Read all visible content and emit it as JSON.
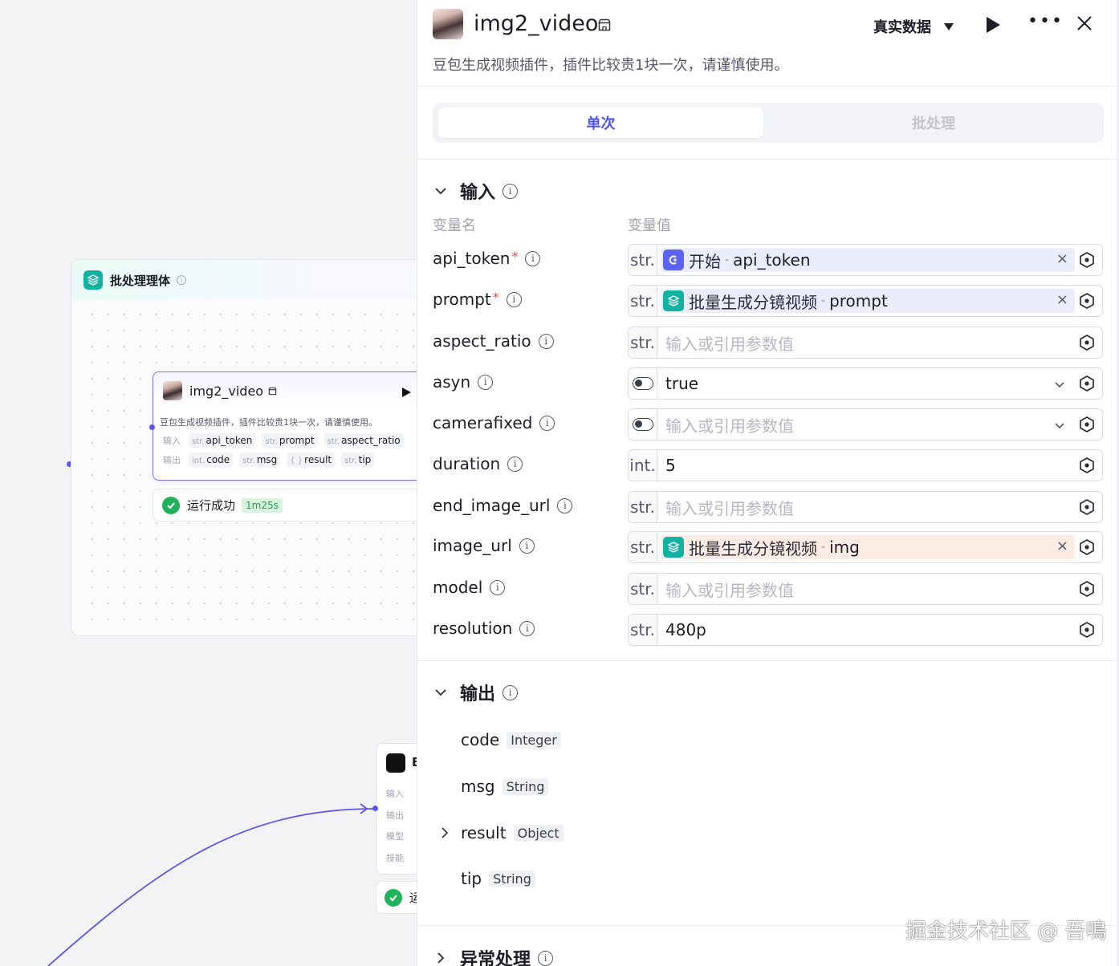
{
  "canvas": {
    "batch_group": {
      "title": "批处理理体"
    },
    "node": {
      "title": "img2_video",
      "description": "豆包生成视频插件，插件比较贵1块一次，请谨慎使用。",
      "input_label": "输入",
      "output_label": "输出",
      "inputs": [
        {
          "type": "str.",
          "name": "api_token"
        },
        {
          "type": "str.",
          "name": "prompt"
        },
        {
          "type": "str.",
          "name": "aspect_ratio"
        }
      ],
      "outputs": [
        {
          "type": "int.",
          "name": "code"
        },
        {
          "type": "str.",
          "name": "msg"
        },
        {
          "type": "{ }",
          "name": "result"
        },
        {
          "type": "str.",
          "name": "tip"
        }
      ]
    },
    "run_status": {
      "text": "运行成功",
      "duration": "1m25s"
    },
    "node2": {
      "title_partial": "E",
      "labels": [
        "输入",
        "输出",
        "模型",
        "技能"
      ],
      "status_partial": "运"
    }
  },
  "panel": {
    "title": "img2_video",
    "description": "豆包生成视频插件，插件比较贵1块一次，请谨慎使用。",
    "mode_label": "真实数据",
    "tabs": {
      "single": "单次",
      "batch": "批处理"
    },
    "input_section": {
      "title": "输入",
      "col_name": "变量名",
      "col_value": "变量值",
      "params": [
        {
          "name": "api_token",
          "required": "*",
          "type": "str.",
          "ref_source": "开始",
          "ref_var": "api_token"
        },
        {
          "name": "prompt",
          "required": "*",
          "type": "str.",
          "ref_source": "批量生成分镜视频",
          "ref_var": "prompt"
        },
        {
          "name": "aspect_ratio",
          "type": "str.",
          "placeholder": "输入或引用参数值"
        },
        {
          "name": "asyn",
          "type": "toggle",
          "value": "true"
        },
        {
          "name": "camerafixed",
          "type": "toggle",
          "placeholder": "输入或引用参数值"
        },
        {
          "name": "duration",
          "type": "int.",
          "value": "5"
        },
        {
          "name": "end_image_url",
          "type": "str.",
          "placeholder": "输入或引用参数值"
        },
        {
          "name": "image_url",
          "type": "str.",
          "ref_source": "批量生成分镜视频",
          "ref_var": "img"
        },
        {
          "name": "model",
          "type": "str.",
          "placeholder": "输入或引用参数值"
        },
        {
          "name": "resolution",
          "type": "str.",
          "value": "480p"
        }
      ],
      "ref_separator": "-"
    },
    "output_section": {
      "title": "输出",
      "outputs": [
        {
          "name": "code",
          "type": "Integer"
        },
        {
          "name": "msg",
          "type": "String"
        },
        {
          "name": "result",
          "type": "Object"
        },
        {
          "name": "tip",
          "type": "String"
        }
      ]
    },
    "error_section": {
      "title": "异常处理"
    }
  },
  "watermark": "掘金技术社区 @ 吾鳴",
  "colors": {
    "accent": "#4d53e8",
    "teal_icon": "#11b3a0",
    "success": "#1fb25a",
    "required": "#e5484d",
    "ref_bg": "#ecedfb",
    "ref_warn_bg": "#fcece4"
  },
  "icons": {
    "start": "start-icon",
    "batch": "layers-icon",
    "store": "store-icon",
    "run": "play-icon",
    "more": "more-icon",
    "close": "close-icon",
    "variable": "variable-icon",
    "dropdown": "chevron-down-icon",
    "info": "info-icon"
  }
}
